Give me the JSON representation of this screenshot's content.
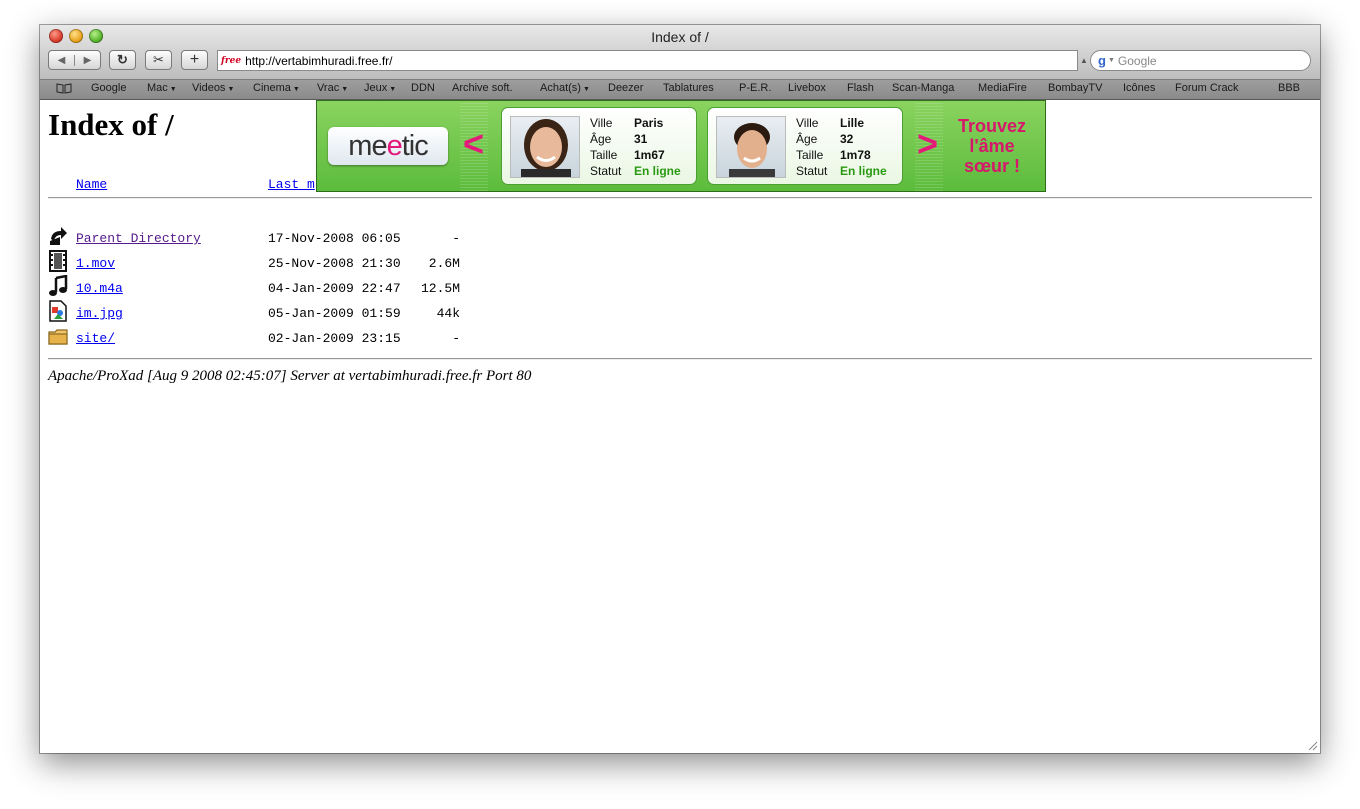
{
  "window": {
    "title": "Index of /"
  },
  "toolbar": {
    "back_label": "◀",
    "forward_label": "▶",
    "reload_label": "↻",
    "snip_label": "✂",
    "add_label": "+",
    "url_favicon": "free",
    "url": "http://vertabimhuradi.free.fr/",
    "search_placeholder": "Google",
    "search_engine_icon": "g"
  },
  "bookmarks": [
    {
      "label": "Google",
      "menu": false
    },
    {
      "label": "Mac",
      "menu": true
    },
    {
      "label": "Videos",
      "menu": true
    },
    {
      "label": "Cinema",
      "menu": true
    },
    {
      "label": "Vrac",
      "menu": true
    },
    {
      "label": "Jeux",
      "menu": true
    },
    {
      "label": "DDN",
      "menu": false
    },
    {
      "label": "Archive soft.",
      "menu": false
    },
    {
      "label": "Achat(s)",
      "menu": true
    },
    {
      "label": "Deezer",
      "menu": false
    },
    {
      "label": "Tablatures",
      "menu": false
    },
    {
      "label": "P-E.R.",
      "menu": false
    },
    {
      "label": "Livebox",
      "menu": false
    },
    {
      "label": "Flash",
      "menu": false
    },
    {
      "label": "Scan-Manga",
      "menu": false
    },
    {
      "label": "MediaFire",
      "menu": false
    },
    {
      "label": "BombayTV",
      "menu": false
    },
    {
      "label": "Icônes",
      "menu": false
    },
    {
      "label": "Forum Crack",
      "menu": false
    },
    {
      "label": "BBB",
      "menu": false
    }
  ],
  "page": {
    "title": "Index of /",
    "headers": {
      "name": "Name",
      "last_modified": "Last m"
    },
    "files": [
      {
        "name": "Parent Directory",
        "date": "17-Nov-2008 06:05",
        "size": "-",
        "icon": "back-arrow-icon",
        "visited": true
      },
      {
        "name": "1.mov",
        "date": "25-Nov-2008 21:30",
        "size": "2.6M",
        "icon": "film-icon",
        "visited": false
      },
      {
        "name": "10.m4a",
        "date": "04-Jan-2009 22:47",
        "size": "12.5M",
        "icon": "music-note-icon",
        "visited": false
      },
      {
        "name": "im.jpg",
        "date": "05-Jan-2009 01:59",
        "size": "44k",
        "icon": "image-file-icon",
        "visited": false
      },
      {
        "name": "site/",
        "date": "02-Jan-2009 23:15",
        "size": "-",
        "icon": "folder-icon",
        "visited": false
      }
    ],
    "address": "Apache/ProXad [Aug 9 2008 02:45:07] Server at vertabimhuradi.free.fr Port 80"
  },
  "ad": {
    "logo_pre": "me",
    "logo_heart": "e",
    "logo_post": "tic",
    "prev_label": "<",
    "next_label": ">",
    "profiles": [
      {
        "ville_label": "Ville",
        "ville": "Paris",
        "age_label": "Âge",
        "age": "31",
        "taille_label": "Taille",
        "taille": "1m67",
        "statut_label": "Statut",
        "statut": "En ligne"
      },
      {
        "ville_label": "Ville",
        "ville": "Lille",
        "age_label": "Âge",
        "age": "32",
        "taille_label": "Taille",
        "taille": "1m78",
        "statut_label": "Statut",
        "statut": "En ligne"
      }
    ],
    "cta_line1": "Trouvez",
    "cta_line2": "l'âme",
    "cta_line3": "sœur !",
    "accent_color": "#e5197a",
    "green_color": "#6cc54a"
  }
}
